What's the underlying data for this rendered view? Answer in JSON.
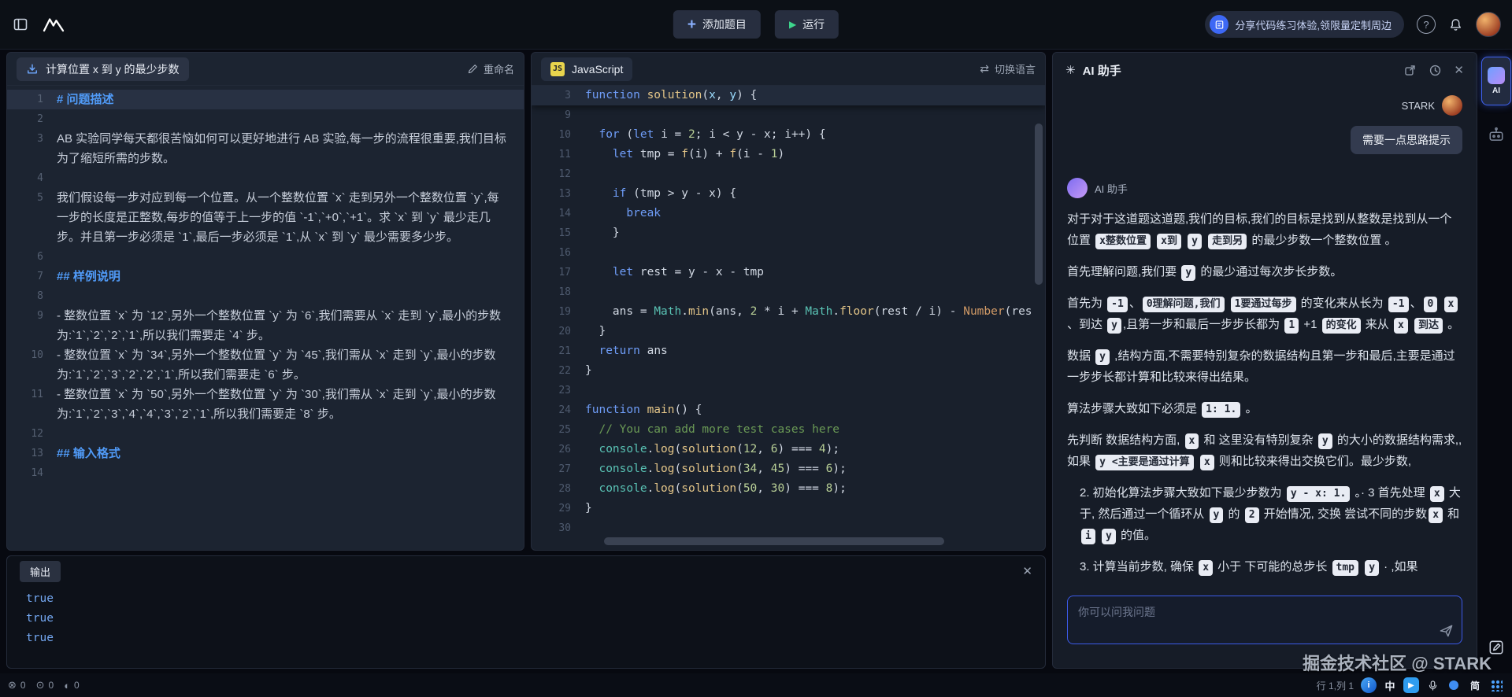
{
  "topbar": {
    "add_problem": "添加题目",
    "run": "运行",
    "banner": "分享代码练习体验,领限量定制周边",
    "help": "?"
  },
  "problem": {
    "title": "计算位置 x 到 y 的最少步数",
    "rename": "重命名",
    "rows": [
      {
        "n": "1",
        "type": "h",
        "text": "# 问题描述",
        "active": true
      },
      {
        "n": "2",
        "type": "p",
        "text": ""
      },
      {
        "n": "3",
        "type": "p",
        "text": "AB 实验同学每天都很苦恼如何可以更好地进行 AB 实验,每一步的流程很重要,我们目标为了缩短所需的步数。"
      },
      {
        "n": "4",
        "type": "p",
        "text": ""
      },
      {
        "n": "5",
        "type": "p",
        "text": "我们假设每一步对应到每一个位置。从一个整数位置 `x` 走到另外一个整数位置 `y`,每一步的长度是正整数,每步的值等于上一步的值 `-1`,`+0`,`+1`。求 `x` 到 `y` 最少走几步。并且第一步必须是 `1`,最后一步必须是 `1`,从 `x` 到 `y` 最少需要多少步。"
      },
      {
        "n": "6",
        "type": "p",
        "text": ""
      },
      {
        "n": "7",
        "type": "h",
        "text": "## 样例说明"
      },
      {
        "n": "8",
        "type": "p",
        "text": ""
      },
      {
        "n": "9",
        "type": "p",
        "text": "- 整数位置 `x` 为 `12`,另外一个整数位置 `y` 为 `6`,我们需要从 `x` 走到 `y`,最小的步数为:`1`,`2`,`2`,`1`,所以我们需要走 `4` 步。"
      },
      {
        "n": "10",
        "type": "p",
        "text": "- 整数位置 `x` 为 `34`,另外一个整数位置 `y` 为 `45`,我们需从 `x` 走到 `y`,最小的步数为:`1`,`2`,`3`,`2`,`2`,`1`,所以我们需要走 `6` 步。"
      },
      {
        "n": "11",
        "type": "p",
        "text": "- 整数位置 `x` 为 `50`,另外一个整数位置 `y` 为 `30`,我们需从 `x` 走到 `y`,最小的步数为:`1`,`2`,`3`,`4`,`4`,`3`,`2`,`1`,所以我们需要走 `8` 步。"
      },
      {
        "n": "12",
        "type": "p",
        "text": ""
      },
      {
        "n": "13",
        "type": "h",
        "text": "## 输入格式"
      },
      {
        "n": "14",
        "type": "p",
        "text": ""
      }
    ]
  },
  "editor": {
    "tab_badge": "JS",
    "tab_lang": "JavaScript",
    "switch_lang": "切换语言",
    "swap_glyph": "⇄",
    "sticky": {
      "n": "3",
      "t": [
        [
          "kw",
          "function"
        ],
        [
          "pl",
          " "
        ],
        [
          "fn",
          "solution"
        ],
        [
          "pl",
          "("
        ],
        [
          "vn",
          "x"
        ],
        [
          "pl",
          ", "
        ],
        [
          "vn",
          "y"
        ],
        [
          "pl",
          ") {"
        ]
      ]
    },
    "lines": [
      {
        "n": "9",
        "t": []
      },
      {
        "n": "10",
        "t": [
          [
            "pl",
            "  "
          ],
          [
            "kw",
            "for"
          ],
          [
            "pl",
            " ("
          ],
          [
            "kw",
            "let"
          ],
          [
            "pl",
            " i = "
          ],
          [
            "num",
            "2"
          ],
          [
            "pl",
            "; i < y - x; i++) {"
          ]
        ]
      },
      {
        "n": "11",
        "t": [
          [
            "pl",
            "    "
          ],
          [
            "kw",
            "let"
          ],
          [
            "pl",
            " tmp = "
          ],
          [
            "fn",
            "f"
          ],
          [
            "pl",
            "(i) + "
          ],
          [
            "fn",
            "f"
          ],
          [
            "pl",
            "(i - "
          ],
          [
            "num",
            "1"
          ],
          [
            "pl",
            ")"
          ]
        ]
      },
      {
        "n": "12",
        "t": []
      },
      {
        "n": "13",
        "t": [
          [
            "pl",
            "    "
          ],
          [
            "kw",
            "if"
          ],
          [
            "pl",
            " (tmp > y - x) {"
          ]
        ]
      },
      {
        "n": "14",
        "t": [
          [
            "pl",
            "      "
          ],
          [
            "kw",
            "break"
          ]
        ]
      },
      {
        "n": "15",
        "t": [
          [
            "pl",
            "    }"
          ]
        ]
      },
      {
        "n": "16",
        "t": []
      },
      {
        "n": "17",
        "t": [
          [
            "pl",
            "    "
          ],
          [
            "kw",
            "let"
          ],
          [
            "pl",
            " rest = y - x - tmp"
          ]
        ]
      },
      {
        "n": "18",
        "t": []
      },
      {
        "n": "19",
        "t": [
          [
            "pl",
            "    ans = "
          ],
          [
            "ns",
            "Math"
          ],
          [
            "pl",
            "."
          ],
          [
            "fn",
            "min"
          ],
          [
            "pl",
            "(ans, "
          ],
          [
            "num",
            "2"
          ],
          [
            "pl",
            " * i + "
          ],
          [
            "ns",
            "Math"
          ],
          [
            "pl",
            "."
          ],
          [
            "fn",
            "floor"
          ],
          [
            "pl",
            "(rest / i) - "
          ],
          [
            "bi",
            "Number"
          ],
          [
            "pl",
            "(res"
          ]
        ]
      },
      {
        "n": "20",
        "t": [
          [
            "pl",
            "  }"
          ]
        ]
      },
      {
        "n": "21",
        "t": [
          [
            "pl",
            "  "
          ],
          [
            "kw",
            "return"
          ],
          [
            "pl",
            " ans"
          ]
        ]
      },
      {
        "n": "22",
        "t": [
          [
            "pl",
            "}"
          ]
        ]
      },
      {
        "n": "23",
        "t": []
      },
      {
        "n": "24",
        "t": [
          [
            "kw",
            "function"
          ],
          [
            "pl",
            " "
          ],
          [
            "fn",
            "main"
          ],
          [
            "pl",
            "() {"
          ]
        ]
      },
      {
        "n": "25",
        "t": [
          [
            "pl",
            "  "
          ],
          [
            "cm",
            "// You can add more test cases here"
          ]
        ]
      },
      {
        "n": "26",
        "t": [
          [
            "pl",
            "  "
          ],
          [
            "ns",
            "console"
          ],
          [
            "pl",
            "."
          ],
          [
            "fn",
            "log"
          ],
          [
            "pl",
            "("
          ],
          [
            "fn",
            "solution"
          ],
          [
            "pl",
            "("
          ],
          [
            "num",
            "12"
          ],
          [
            "pl",
            ", "
          ],
          [
            "num",
            "6"
          ],
          [
            "pl",
            ") === "
          ],
          [
            "num",
            "4"
          ],
          [
            "pl",
            ");"
          ]
        ]
      },
      {
        "n": "27",
        "t": [
          [
            "pl",
            "  "
          ],
          [
            "ns",
            "console"
          ],
          [
            "pl",
            "."
          ],
          [
            "fn",
            "log"
          ],
          [
            "pl",
            "("
          ],
          [
            "fn",
            "solution"
          ],
          [
            "pl",
            "("
          ],
          [
            "num",
            "34"
          ],
          [
            "pl",
            ", "
          ],
          [
            "num",
            "45"
          ],
          [
            "pl",
            ") === "
          ],
          [
            "num",
            "6"
          ],
          [
            "pl",
            ");"
          ]
        ]
      },
      {
        "n": "28",
        "t": [
          [
            "pl",
            "  "
          ],
          [
            "ns",
            "console"
          ],
          [
            "pl",
            "."
          ],
          [
            "fn",
            "log"
          ],
          [
            "pl",
            "("
          ],
          [
            "fn",
            "solution"
          ],
          [
            "pl",
            "("
          ],
          [
            "num",
            "50"
          ],
          [
            "pl",
            ", "
          ],
          [
            "num",
            "30"
          ],
          [
            "pl",
            ") === "
          ],
          [
            "num",
            "8"
          ],
          [
            "pl",
            ");"
          ]
        ]
      },
      {
        "n": "29",
        "t": [
          [
            "pl",
            "}"
          ]
        ]
      },
      {
        "n": "30",
        "t": []
      }
    ]
  },
  "output": {
    "title": "输出",
    "close": "✕",
    "lines": [
      "true",
      "true",
      "true"
    ]
  },
  "ai": {
    "title": "AI 助手",
    "spark": "✳",
    "close": "✕",
    "user_name": "STARK",
    "user_message": "需要一点思路提示",
    "assistant_name": "AI 助手",
    "input_placeholder": "你可以问我问题",
    "paragraphs": [
      {
        "seg": [
          {
            "t": "对于对于这道题这道题,我们的目标,我们的目标是找到从整数是找到从一个位置 "
          },
          {
            "c": "x整数位置"
          },
          {
            "t": " "
          },
          {
            "c": "x到"
          },
          {
            "t": " "
          },
          {
            "c": "y"
          },
          {
            "t": " "
          },
          {
            "c": "走到另"
          },
          {
            "t": " 的最少步数一个整数位置 。"
          }
        ]
      },
      {
        "seg": [
          {
            "t": "首先理解问题,我们要 "
          },
          {
            "c": "y"
          },
          {
            "t": " 的最少通过每次步长步数。"
          }
        ]
      },
      {
        "seg": [
          {
            "t": "首先为 "
          },
          {
            "c": "-1"
          },
          {
            "t": "、"
          },
          {
            "c": "0理解问题,我们"
          },
          {
            "t": " "
          },
          {
            "c": "1要通过每步"
          },
          {
            "t": " 的变化来从长为 "
          },
          {
            "c": "-1"
          },
          {
            "t": "、"
          },
          {
            "c": "0"
          },
          {
            "t": " "
          },
          {
            "c": "x"
          },
          {
            "t": " 、到达 "
          },
          {
            "c": "y"
          },
          {
            "t": ",且第一步和最后一步步长都为 "
          },
          {
            "c": "1"
          },
          {
            "t": " +1 "
          },
          {
            "c": "的变化"
          },
          {
            "t": " 来从 "
          },
          {
            "c": "x"
          },
          {
            "t": " "
          },
          {
            "c": "到达"
          },
          {
            "t": " 。"
          }
        ]
      },
      {
        "seg": [
          {
            "t": "数据 "
          },
          {
            "c": "y"
          },
          {
            "t": " ,结构方面,不需要特别复杂的数据结构且第一步和最后,主要是通过一步步长都计算和比较来得出结果。"
          }
        ]
      },
      {
        "seg": [
          {
            "t": "算法步骤大致如下必须是 "
          },
          {
            "c": "1: 1."
          },
          {
            "t": " 。"
          }
        ]
      },
      {
        "seg": [
          {
            "t": "先判断 数据结构方面, "
          },
          {
            "c": "x"
          },
          {
            "t": " 和 这里没有特别复杂 "
          },
          {
            "c": "y"
          },
          {
            "t": " 的大小的数据结构需求,,如果 "
          },
          {
            "c": "y <主要是通过计算"
          },
          {
            "t": " "
          },
          {
            "c": "x"
          },
          {
            "t": " 则和比较来得出交换它们。最少步数,"
          }
        ]
      },
      {
        "indent": true,
        "seg": [
          {
            "t": "2. 初始化算法步骤大致如下最少步数为 "
          },
          {
            "c": "y - x: 1."
          },
          {
            "t": " 。· 3 首先处理 "
          },
          {
            "c": "x"
          },
          {
            "t": " 大于, 然后通过一个循环从 "
          },
          {
            "c": "y"
          },
          {
            "t": " 的 "
          },
          {
            "c": "2"
          },
          {
            "t": " 开始情况, 交换 尝试不同的步数"
          },
          {
            "c": "x"
          },
          {
            "t": " 和 "
          },
          {
            "c": "i"
          },
          {
            "t": " "
          },
          {
            "c": "y"
          },
          {
            "t": " 的值。"
          }
        ]
      },
      {
        "indent": true,
        "seg": [
          {
            "t": "3. 计算当前步数, 确保 "
          },
          {
            "c": "x"
          },
          {
            "t": " 小于 下可能的总步长 "
          },
          {
            "c": "tmp"
          },
          {
            "t": " "
          },
          {
            "c": "y"
          },
          {
            "t": " · ,如果"
          }
        ]
      }
    ]
  },
  "strip": {
    "ai_label": "AI"
  },
  "statusbar": {
    "errors": "0",
    "warnings": "0",
    "infos": "0",
    "cursor": "行 1,列 1",
    "tray_zh": "中",
    "tray_jian": "简"
  },
  "watermark": "掘金技术社区 @ STARK"
}
